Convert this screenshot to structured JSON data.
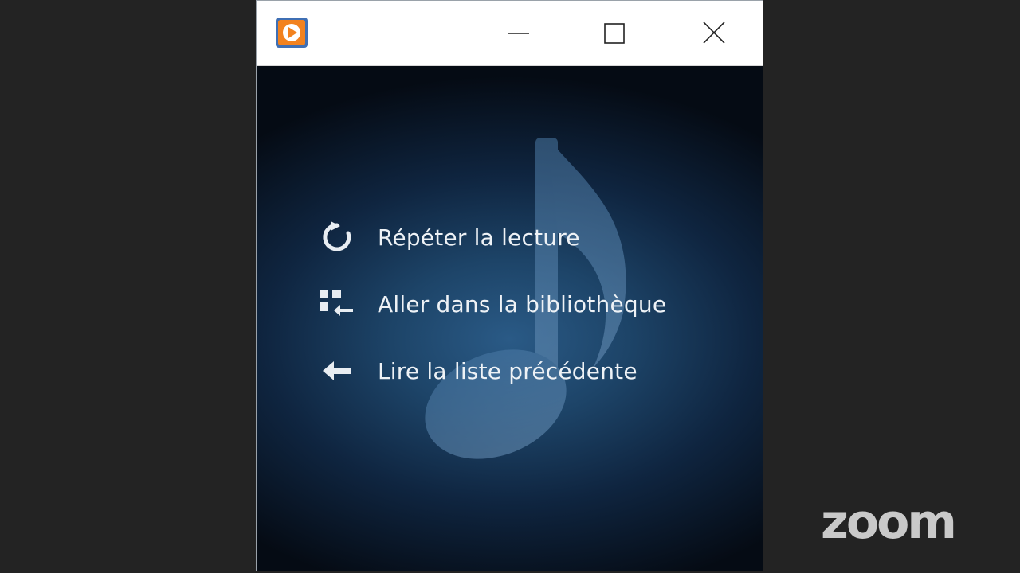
{
  "window": {
    "titlebar": {
      "app_icon": "media-player-play-icon",
      "controls": {
        "minimize_icon": "minimize-icon",
        "maximize_icon": "maximize-icon",
        "close_icon": "close-icon"
      }
    },
    "background_icon": "music-note-icon",
    "menu": {
      "items": [
        {
          "label": "Répéter la lecture",
          "icon": "repeat-icon"
        },
        {
          "label": "Aller dans la bibliothèque",
          "icon": "library-icon"
        },
        {
          "label": "Lire la liste précédente",
          "icon": "back-arrow-icon"
        }
      ]
    }
  },
  "overlay": {
    "logo_text": "zoom"
  },
  "colors": {
    "page_background": "#232323",
    "titlebar": "#ffffff",
    "app_icon_orange": "#f2821f",
    "app_icon_blue": "#3f6fb4",
    "content_glow": "#2a5a86",
    "text": "#eef2f6",
    "logo": "#c9c9c9"
  }
}
